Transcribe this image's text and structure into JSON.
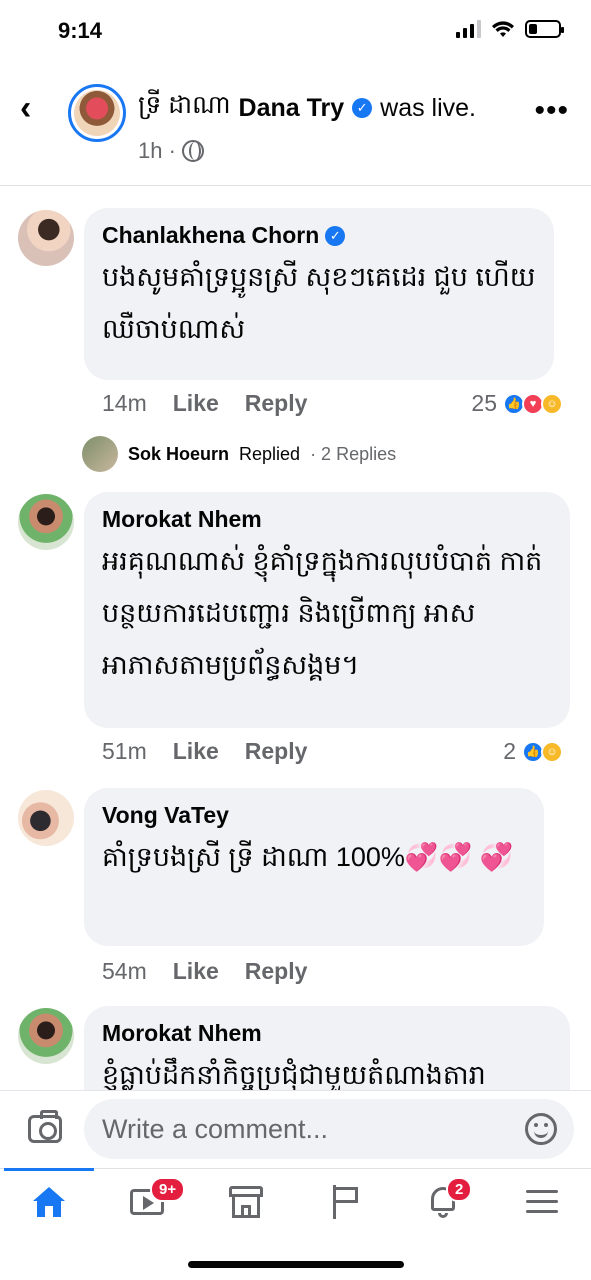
{
  "status_bar": {
    "time": "9:14",
    "battery_fraction": 0.3
  },
  "header": {
    "khmer_name": "ទ្រី ដាណា",
    "name": "Dana Try",
    "action": "was live.",
    "time": "1h ·",
    "verified_mark": "✓",
    "more": "•••",
    "back": "‹"
  },
  "comments": [
    {
      "author": "Chanlakhena Chorn",
      "verified": true,
      "text": "បងសូមគាំទ្រប្អូនស្រី  សុខៗគេដេរ ជួប ហើយ ឈឺចាប់ណាស់",
      "time": "14m",
      "like": "Like",
      "reply": "Reply",
      "reaction_count": "25",
      "reaction_icons": [
        "like-icon",
        "love-icon",
        "care-icon"
      ]
    },
    {
      "author": "Morokat Nhem",
      "text": "អរគុណណាស់ ខ្ញុំគាំទ្រក្នុងការលុបបំបាត់ កាត់បន្ថយការដេបញ្ជោរ និងប្រើពាក្យ អាសអាភាសតាមប្រព័ន្ធសង្គម។",
      "time": "51m",
      "like": "Like",
      "reply": "Reply",
      "reaction_count": "2",
      "reaction_icons": [
        "like-icon",
        "care-icon"
      ]
    },
    {
      "author": "Vong VaTey",
      "text": "គាំទ្របងស្រី ទ្រី ដាណា 100%💞💞 💞",
      "time": "54m",
      "like": "Like",
      "reply": "Reply"
    },
    {
      "author": "Morokat Nhem",
      "text": "ខ្ញុំធ្លាប់ដឹកនាំកិច្ចប្រជុំជាមួយតំណាងតារា"
    }
  ],
  "replies": {
    "author": "Sok Hoeurn",
    "replied": "Replied",
    "count": "· 2 Replies"
  },
  "composer": {
    "placeholder": "Write a comment..."
  },
  "nav": {
    "video_badge": "9+",
    "notif_badge": "2"
  },
  "colors": {
    "accent": "#1877f2",
    "bubble": "#f0f2f5",
    "muted": "#65676b",
    "badge": "#e41e3f"
  }
}
